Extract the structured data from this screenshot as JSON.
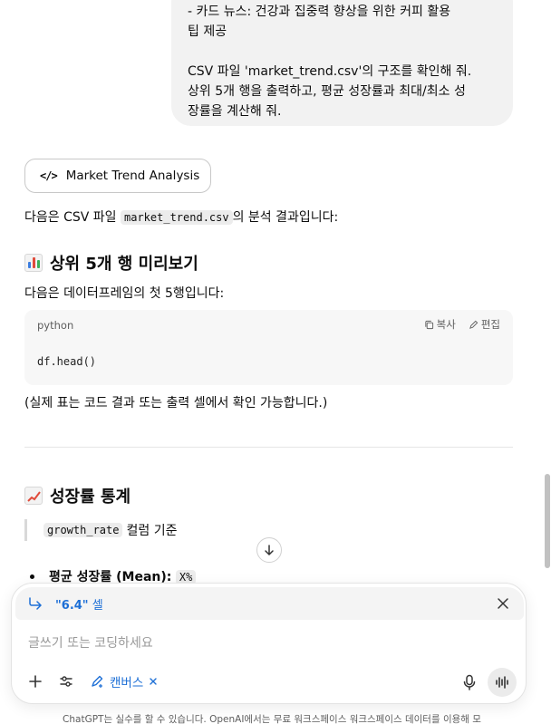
{
  "user_message": {
    "lines": [
      "- 카드 뉴스: 건강과 집중력 향상을 위한 커피 활용",
      "팁 제공",
      "",
      "CSV 파일 'market_trend.csv'의 구조를 확인해 줘.",
      "상위 5개 행을 출력하고, 평균 성장률과 최대/최소 성",
      "장률을 계산해 줘."
    ]
  },
  "canvas_chip": {
    "label": "Market Trend Analysis",
    "icon": "code-icon"
  },
  "intro": {
    "before": "다음은 CSV 파일 ",
    "code": "market_trend.csv",
    "after": "의 분석 결과입니다:"
  },
  "section1": {
    "title": "상위 5개 행 미리보기",
    "icon": "bar-chart-emoji"
  },
  "section1_text": "다음은 데이터프레임의 첫 5행입니다:",
  "code_block": {
    "language": "python",
    "copy_label": "복사",
    "edit_label": "편집",
    "code": "df.head()"
  },
  "note": "(실제 표는 코드 결과 또는 출력 셀에서 확인 가능합니다.)",
  "section2": {
    "title": "성장률 통계",
    "icon": "line-chart-emoji"
  },
  "quote": {
    "code": "growth_rate",
    "text": "컬럼 기준"
  },
  "bullet": {
    "label": "평균 성장률 (Mean):",
    "value": "X%"
  },
  "composer": {
    "reply_quote": "\"6.4\"",
    "reply_text": "셀",
    "placeholder": "글쓰기 또는 코딩하세요",
    "canvas_tag": "캔버스"
  },
  "footer": "ChatGPT는 실수를 할 수 있습니다. OpenAI에서는 무료 워크스페이스 워크스페이스 데이터를 이용해 모",
  "colors": {
    "accent": "#1d6fd6",
    "bubble": "#f2f2f2",
    "code_bg": "#f7f7f7"
  }
}
